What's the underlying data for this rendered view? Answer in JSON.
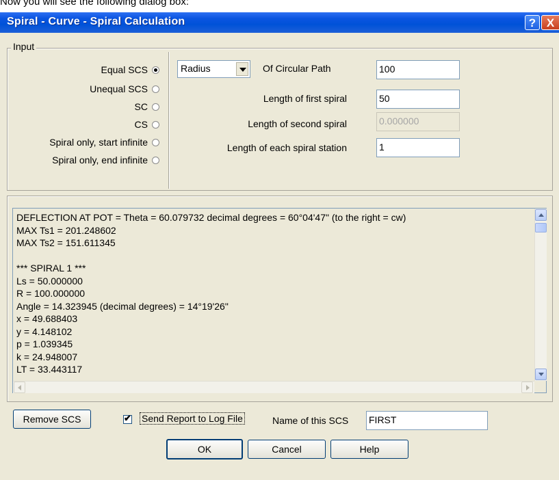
{
  "caption": "Now you will see the following dialog box:",
  "window": {
    "title": "Spiral - Curve - Spiral Calculation",
    "help_glyph": "?",
    "close_glyph": "X",
    "titlebar_color": "#0a54e0"
  },
  "input": {
    "legend": "Input",
    "radios": [
      {
        "label": "Equal SCS",
        "checked": true
      },
      {
        "label": "Unequal SCS",
        "checked": false
      },
      {
        "label": "SC",
        "checked": false
      },
      {
        "label": "CS",
        "checked": false
      },
      {
        "label": "Spiral only, start infinite",
        "checked": false
      },
      {
        "label": "Spiral only, end infinite",
        "checked": false
      }
    ],
    "dropdown_value": "Radius",
    "fields": [
      {
        "label": "Of Circular Path",
        "value": "100"
      },
      {
        "label": "Length of first spiral",
        "value": "50"
      },
      {
        "label": "Length of second spiral",
        "value": "0.000000",
        "disabled": true
      },
      {
        "label": "Length of each spiral station",
        "value": "1"
      }
    ]
  },
  "report": {
    "lines": [
      "DEFLECTION AT POT = Theta = 60.079732 decimal degrees = 60°04'47\" (to the right = cw)",
      "MAX Ts1 = 201.248602",
      "MAX Ts2 = 151.611345",
      "",
      "*** SPIRAL 1 ***",
      "Ls = 50.000000",
      "R = 100.000000",
      "Angle = 14.323945 (decimal degrees) = 14°19'26\"",
      "x = 49.688403",
      "y = 4.148102",
      "p = 1.039345",
      "k = 24.948007",
      "LT = 33.443117"
    ]
  },
  "bottom": {
    "remove_label": "Remove SCS",
    "send_report_label": "Send Report to Log File",
    "send_report_checked": true,
    "check_glyph": "✔",
    "name_label": "Name of this SCS",
    "name_value": "FIRST",
    "ok_label": "OK",
    "cancel_label": "Cancel",
    "help_label": "Help"
  }
}
